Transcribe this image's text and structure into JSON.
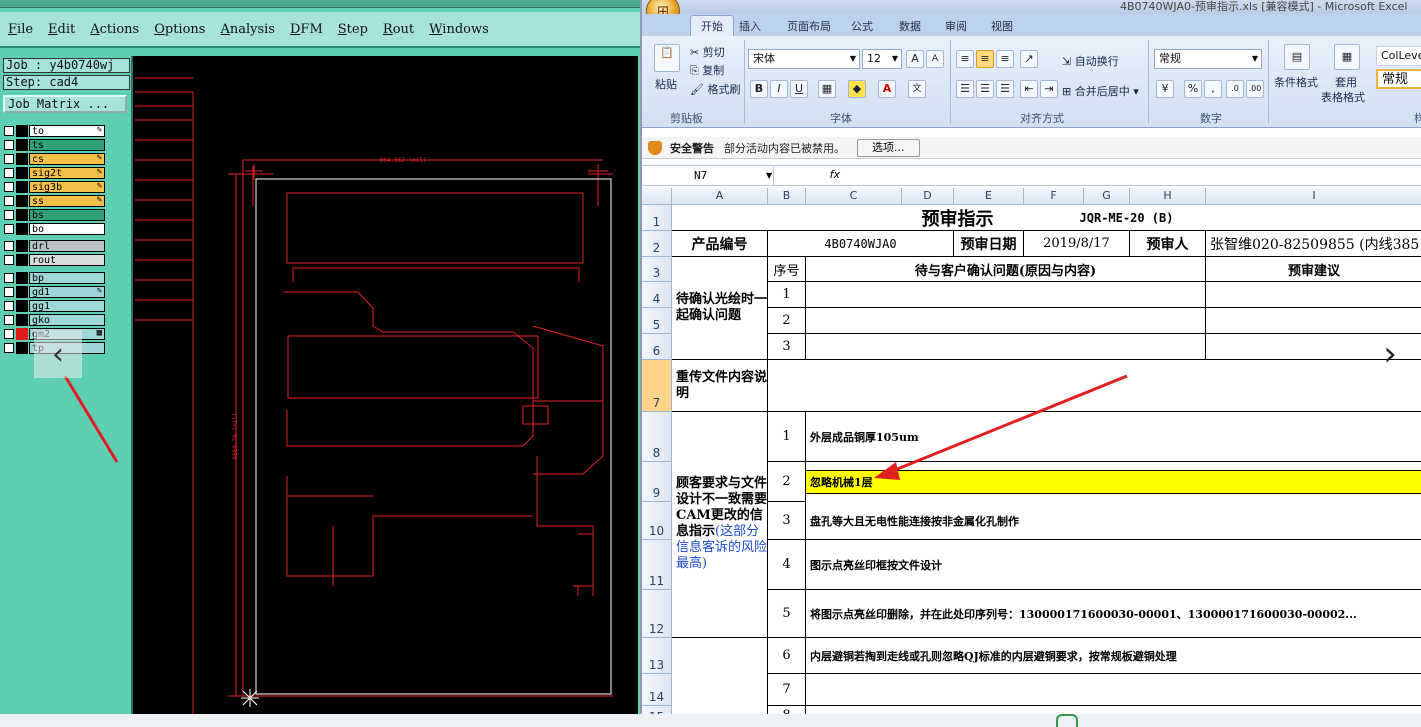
{
  "cam": {
    "menu": [
      "File",
      "Edit",
      "Actions",
      "Options",
      "Analysis",
      "DFM",
      "Step",
      "Rout",
      "Windows"
    ],
    "job_label": "Job : y4b0740wj",
    "step_label": "Step: cad4",
    "job_matrix_button": "Job Matrix ...",
    "layers": [
      {
        "name": "to",
        "color": "#ffffff",
        "pen": "✎"
      },
      {
        "name": "ts",
        "color": "#2fa078",
        "pen": ""
      },
      {
        "name": "cs",
        "color": "#f5c048",
        "pen": "✎"
      },
      {
        "name": "sig2t",
        "color": "#f5c048",
        "pen": "✎"
      },
      {
        "name": "sig3b",
        "color": "#f5c048",
        "pen": "✎"
      },
      {
        "name": "ss",
        "color": "#f5c048",
        "pen": "✎"
      },
      {
        "name": "bs",
        "color": "#2fa078",
        "pen": ""
      },
      {
        "name": "bo",
        "color": "#ffffff",
        "pen": ""
      },
      {
        "name": "drl",
        "color": "#b8c2c4",
        "pen": ""
      },
      {
        "name": "rout",
        "color": "#d8dcdc",
        "pen": ""
      },
      {
        "name": "bp",
        "color": "#9fd6d8",
        "pen": ""
      },
      {
        "name": "gd1",
        "color": "#9fd6d8",
        "pen": "✎"
      },
      {
        "name": "gg1",
        "color": "#9fd6d8",
        "pen": ""
      },
      {
        "name": "gko",
        "color": "#9fd6d8",
        "pen": ""
      },
      {
        "name": "gm2",
        "color": "#9fd6d8",
        "pen": "▦"
      },
      {
        "name": "tp",
        "color": "#9fd6d8",
        "pen": ""
      }
    ],
    "canvas_dimension_top": "004.362 (mil)",
    "canvas_dimension_left": "6660.76 (mil)",
    "nav_prev": "‹"
  },
  "excel": {
    "title": "4B0740WJA0-预审指示.xls  [兼容模式] - Microsoft Excel",
    "tabs": [
      "开始",
      "插入",
      "页面布局",
      "公式",
      "数据",
      "审阅",
      "视图"
    ],
    "ribbon": {
      "paste": "粘贴",
      "cut": "剪切",
      "copy": "复制",
      "format_painter": "格式刷",
      "clipboard_label": "剪贴板",
      "font_name": "宋体",
      "font_size": "12",
      "font_label": "字体",
      "wrap_text": "自动换行",
      "merge_center": "合并后居中",
      "alignment_label": "对齐方式",
      "number_format": "常规",
      "number_label": "数字",
      "conditional_format": "条件格式",
      "table_format_1": "套用",
      "table_format_2": "表格格式",
      "style_name_1": "ColLevel",
      "style_name_2": "常规",
      "styles_label": "样"
    },
    "security": {
      "title": "安全警告",
      "message": "部分活动内容已被禁用。",
      "options_button": "选项..."
    },
    "name_box": "N7",
    "fx": "fx",
    "columns": [
      "A",
      "B",
      "C",
      "D",
      "E",
      "F",
      "G",
      "H",
      "I"
    ],
    "rows": [
      "1",
      "2",
      "3",
      "4",
      "5",
      "6",
      "7",
      "8",
      "9",
      "10",
      "11",
      "12",
      "13",
      "14",
      "15"
    ],
    "sheet": {
      "title": "预审指示",
      "doc_code": "JQR-ME-20 (B)",
      "product_no_label": "产品编号",
      "product_no": "4B0740WJA0",
      "review_date_label": "预审日期",
      "review_date": "2019/8/17",
      "reviewer_label": "预审人",
      "reviewer": "张智维020-82509855 (内线385",
      "seq_label": "序号",
      "issues_label": "待与客户确认问题(原因与内容)",
      "suggestion_label": "预审建议",
      "confirm_group": "待确认光绘时一起确认问题",
      "confirm_rows": [
        "1",
        "2",
        "3"
      ],
      "reupload_label": "重传文件内容说明",
      "diff_group_1": "顾客要求与文件设计不一致需要CAM更改的信息指示",
      "diff_group_2": "(这部分信息客诉的风险最高)",
      "items": [
        {
          "no": "1",
          "text": "外层成品铜厚105um"
        },
        {
          "no": "2",
          "text": "忽略机械1层"
        },
        {
          "no": "3",
          "text": "盘孔等大且无电性能连接按非金属化孔制作"
        },
        {
          "no": "4",
          "text": "图示点亮丝印框按文件设计"
        },
        {
          "no": "5",
          "text": "将图示点亮丝印删除，并在此处印序列号：130000171600030-00001、130000171600030-00002..."
        },
        {
          "no": "6",
          "text": "内层避铜若掏到走线或孔则忽略QJ标准的内层避铜要求，按常规板避铜处理"
        },
        {
          "no": "7",
          "text": ""
        },
        {
          "no": "8",
          "text": ""
        }
      ]
    },
    "nav_next": "›",
    "colors": {
      "highlight_row": "#ffff00",
      "selected_row_header": "#ffd48a",
      "annotation_arrow": "#e02020"
    }
  }
}
